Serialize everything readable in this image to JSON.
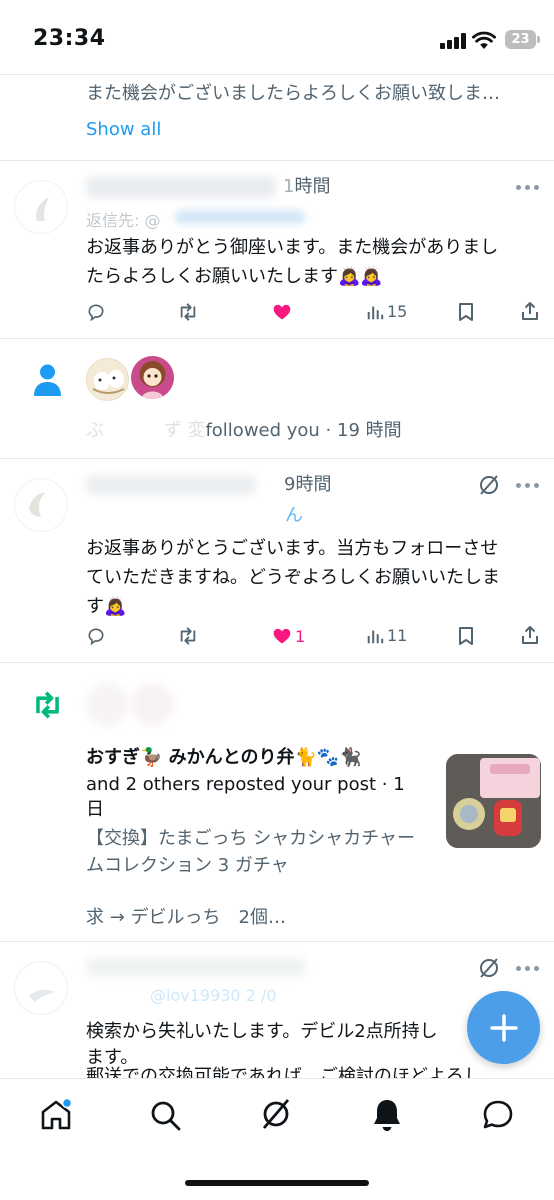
{
  "status_bar": {
    "time": "23:34",
    "battery": "23"
  },
  "items": {
    "top_reply": {
      "text": "また機会がございましたらよろしくお願い致しま…",
      "show_all": "Show all"
    },
    "reply1": {
      "header_visible": "時間",
      "header_hour_digit": "1",
      "reply_to": "返信先: @",
      "text_line1": "お返事ありがとう御座います。また機会がありまし",
      "text_line2": "たらよろしくお願いいたします🙇‍♀️🙇‍♀️",
      "views": "15",
      "liked": true
    },
    "follow": {
      "text": "followed you · 19 時間",
      "prefix_faded": "ぶ　　　  ず 変"
    },
    "reply2": {
      "header_visible": "9時間",
      "name_tail": "ん",
      "text_line1": "お返事ありがとうございます。当方もフォローさせ",
      "text_line2": "ていただきますね。どうぞよろしくお願いいたしま",
      "text_line3": "す🙇‍♀️",
      "likes": "1",
      "views": "11",
      "liked": true
    },
    "repost": {
      "names": "おすぎ🦆 みかんとのり弁🐈🐾🐈‍⬛",
      "action_line1": "and 2 others reposted your post · 1",
      "action_line2": "日",
      "post_line1": "【交換】たまごっち シャカシャカチャー",
      "post_line2": "ムコレクション 3 ガチャ",
      "post_line3": "求 → デビルっち　2個…"
    },
    "reply3": {
      "handle_faded": "@lov19930 2 /0",
      "text_line1": "検索から失礼いたします。デビル2点所持し",
      "text_line2": "ます。",
      "text_line3": "郵送での交換可能であれば、ご検討のほどよろし"
    }
  },
  "colors": {
    "accent": "#1d9bf0",
    "like": "#f91880",
    "repost": "#00ba7c",
    "fab": "#4d9ee9"
  },
  "icons": [
    "home-icon",
    "search-icon",
    "grok-icon",
    "bell-icon",
    "messages-icon",
    "compose-icon"
  ]
}
